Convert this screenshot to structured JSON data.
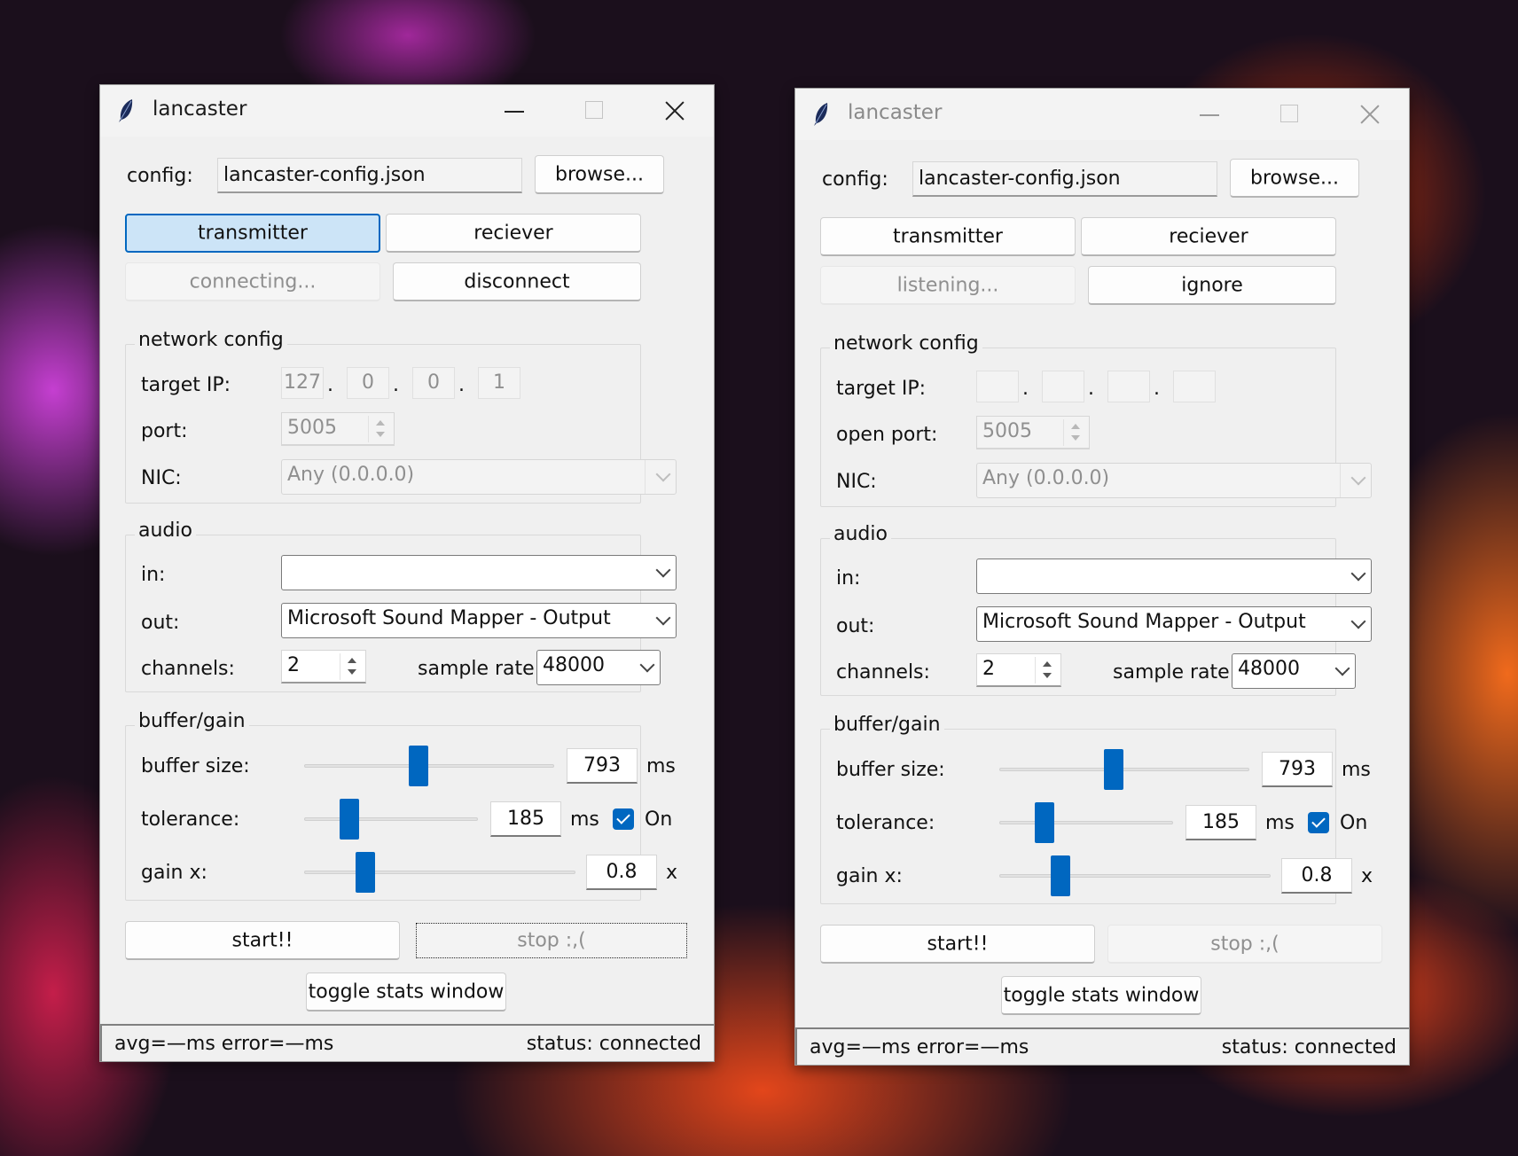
{
  "windows": [
    {
      "title": "lancaster",
      "config_label": "config:",
      "config_value": "lancaster-config.json",
      "browse_label": "browse...",
      "mode_transmitter": "transmitter",
      "mode_receiver": "reciever",
      "status_button": "connecting...",
      "action_button": "disconnect",
      "network": {
        "title": "network config",
        "ip_label": "target IP:",
        "ip": [
          "127",
          "0",
          "0",
          "1"
        ],
        "port_label": "port:",
        "port": "5005",
        "nic_label": "NIC:",
        "nic": "Any (0.0.0.0)"
      },
      "audio": {
        "title": "audio",
        "in_label": "in:",
        "in_value": "",
        "out_label": "out:",
        "out_value": "Microsoft Sound Mapper - Output",
        "channels_label": "channels:",
        "channels": "2",
        "rate_label": "sample rate:",
        "rate": "48000"
      },
      "buffer": {
        "title": "buffer/gain",
        "buffer_label": "buffer size:",
        "buffer_value": "793",
        "buffer_unit": "ms",
        "tolerance_label": "tolerance:",
        "tolerance_value": "185",
        "tolerance_unit": "ms",
        "tolerance_on": "On",
        "gain_label": "gain x:",
        "gain_value": "0.8",
        "gain_unit": "x"
      },
      "start_label": "start!!",
      "stop_label": "stop :,(",
      "stats_label": "toggle stats window",
      "status_left": "avg=—ms  error=—ms",
      "status_right": "status: connected"
    },
    {
      "title": "lancaster",
      "config_label": "config:",
      "config_value": "lancaster-config.json",
      "browse_label": "browse...",
      "mode_transmitter": "transmitter",
      "mode_receiver": "reciever",
      "status_button": "listening...",
      "action_button": "ignore",
      "network": {
        "title": "network config",
        "ip_label": "target IP:",
        "ip": [
          "",
          "",
          "",
          ""
        ],
        "port_label": "open port:",
        "port": "5005",
        "nic_label": "NIC:",
        "nic": "Any (0.0.0.0)"
      },
      "audio": {
        "title": "audio",
        "in_label": "in:",
        "in_value": "",
        "out_label": "out:",
        "out_value": "Microsoft Sound Mapper - Output",
        "channels_label": "channels:",
        "channels": "2",
        "rate_label": "sample rate:",
        "rate": "48000"
      },
      "buffer": {
        "title": "buffer/gain",
        "buffer_label": "buffer size:",
        "buffer_value": "793",
        "buffer_unit": "ms",
        "tolerance_label": "tolerance:",
        "tolerance_value": "185",
        "tolerance_unit": "ms",
        "tolerance_on": "On",
        "gain_label": "gain x:",
        "gain_value": "0.8",
        "gain_unit": "x"
      },
      "start_label": "start!!",
      "stop_label": "stop :,(",
      "stats_label": "toggle stats window",
      "status_left": "avg=—ms  error=—ms",
      "status_right": "status: connected"
    }
  ],
  "colors": {
    "accent": "#0067c0",
    "selected_bg": "#cce4f7",
    "window_bg": "#f0f0f0",
    "disabled_text": "#8f8f8f"
  }
}
